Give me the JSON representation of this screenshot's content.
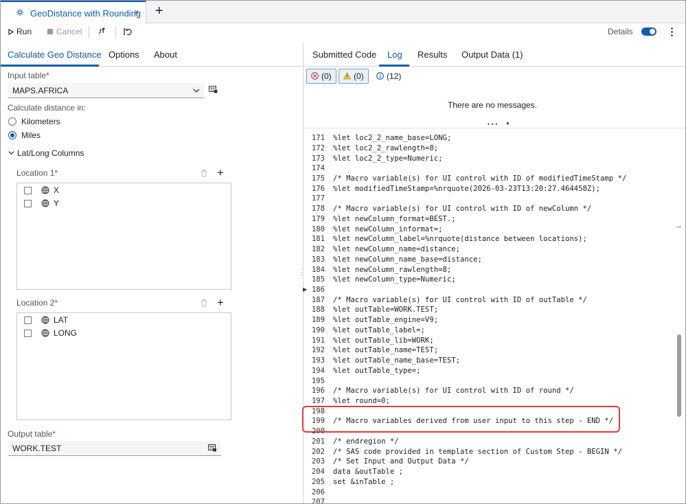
{
  "tab": {
    "title": "GeoDistance with Rounding",
    "close": "×",
    "add": "+"
  },
  "toolbar": {
    "run": "Run",
    "cancel": "Cancel",
    "details": "Details",
    "more": "⋮"
  },
  "left_tabs": [
    "Calculate Geo Distance",
    "Options",
    "About"
  ],
  "form": {
    "input_table_label": "Input table",
    "input_table_value": "MAPS.AFRICA",
    "required_mark": "*",
    "distance_label": "Calculate distance in:",
    "units": [
      {
        "label": "Kilometers",
        "selected": false
      },
      {
        "label": "Miles",
        "selected": true
      }
    ],
    "section_title": "Lat/Long Columns",
    "location1": {
      "label": "Location  1",
      "columns": [
        "X",
        "Y"
      ]
    },
    "location2": {
      "label": "Location 2",
      "columns": [
        "LAT",
        "LONG"
      ]
    },
    "output_table_label": "Output table",
    "output_table_value": "WORK.TEST"
  },
  "right_tabs": [
    "Submitted Code",
    "Log",
    "Results",
    "Output Data (1)"
  ],
  "log_filters": {
    "errors": "(0)",
    "warnings": "(0)",
    "notes": "(12)"
  },
  "no_messages": "There are no messages.",
  "code_lines": [
    {
      "n": "171",
      "t": "%let loc2_2_name_base=LONG;"
    },
    {
      "n": "172",
      "t": "%let loc2_2_rawlength=8;"
    },
    {
      "n": "173",
      "t": "%let loc2_2_type=Numeric;"
    },
    {
      "n": "174",
      "t": ""
    },
    {
      "n": "175",
      "t": "/* Macro variable(s) for UI control with ID of modifiedTimeStamp */"
    },
    {
      "n": "176",
      "t": "%let modifiedTimeStamp=%nrquote(2026-03-23T13:20:27.464458Z);"
    },
    {
      "n": "177",
      "t": ""
    },
    {
      "n": "178",
      "t": "/* Macro variable(s) for UI control with ID of newColumn */"
    },
    {
      "n": "179",
      "t": "%let newColumn_format=BEST.;"
    },
    {
      "n": "180",
      "t": "%let newColumn_informat=;"
    },
    {
      "n": "181",
      "t": "%let newColumn_label=%nrquote(distance between locations);"
    },
    {
      "n": "182",
      "t": "%let newColumn_name=distance;"
    },
    {
      "n": "183",
      "t": "%let newColumn_name_base=distance;"
    },
    {
      "n": "184",
      "t": "%let newColumn_rawlength=8;"
    },
    {
      "n": "185",
      "t": "%let newColumn_type=Numeric;"
    },
    {
      "n": "186",
      "t": ""
    },
    {
      "n": "187",
      "t": "/* Macro variable(s) for UI control with ID of outTable */"
    },
    {
      "n": "188",
      "t": "%let outTable=WORK.TEST;"
    },
    {
      "n": "189",
      "t": "%let outTable_engine=V9;"
    },
    {
      "n": "190",
      "t": "%let outTable_label=;"
    },
    {
      "n": "191",
      "t": "%let outTable_lib=WORK;"
    },
    {
      "n": "192",
      "t": "%let outTable_name=TEST;"
    },
    {
      "n": "193",
      "t": "%let outTable_name_base=TEST;"
    },
    {
      "n": "194",
      "t": "%let outTable_type=;"
    },
    {
      "n": "195",
      "t": ""
    },
    {
      "n": "196",
      "t": "/* Macro variable(s) for UI control with ID of round */"
    },
    {
      "n": "197",
      "t": "%let round=0;"
    },
    {
      "n": "198",
      "t": ""
    },
    {
      "n": "199",
      "t": "/* Macro variables derived from user input to this step - END */"
    },
    {
      "n": "200",
      "t": ""
    },
    {
      "n": "201",
      "t": "/* endregion */"
    },
    {
      "n": "202",
      "t": "/* SAS code provided in template section of Custom Step - BEGIN */"
    },
    {
      "n": "203",
      "t": "/* Set Input and Output Data */"
    },
    {
      "n": "204",
      "t": "data &outTable ;"
    },
    {
      "n": "205",
      "t": "set &inTable ;"
    },
    {
      "n": "206",
      "t": ""
    },
    {
      "n": "207",
      "t": ""
    }
  ],
  "colors": {
    "accent": "#0b5cad",
    "highlight": "#e0393e",
    "error": "#c0392b",
    "warning": "#d9a400"
  }
}
